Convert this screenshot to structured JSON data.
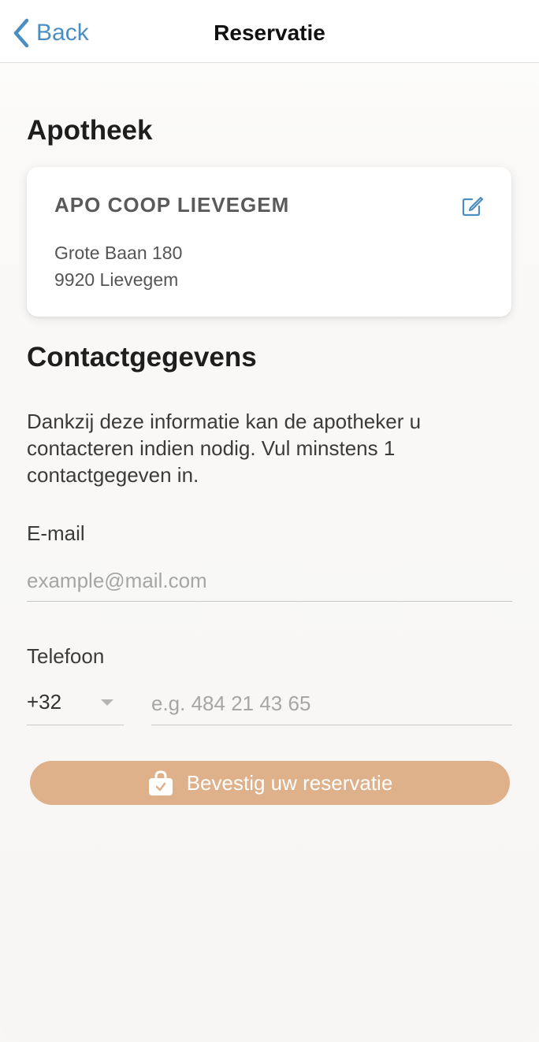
{
  "header": {
    "back_label": "Back",
    "title": "Reservatie"
  },
  "pharmacy": {
    "section_title": "Apotheek",
    "name": "APO COOP LIEVEGEM",
    "address_line1": "Grote Baan 180",
    "address_line2": "9920 Lievegem",
    "edit_icon": "edit-icon"
  },
  "contact": {
    "section_title": "Contactgegevens",
    "description": "Dankzij deze informatie kan de apotheker u contacteren indien nodig. Vul minstens 1 contactgegeven in.",
    "email": {
      "label": "E-mail",
      "value": "",
      "placeholder": "example@mail.com"
    },
    "phone": {
      "label": "Telefoon",
      "country_code": "+32",
      "value": "",
      "placeholder": "e.g. 484 21 43 65"
    }
  },
  "confirm": {
    "label": "Bevestig uw reservatie",
    "icon": "shopping-bag-check-icon"
  },
  "colors": {
    "accent": "#4b8fc0",
    "button": "#dfb18b",
    "background": "#f8f7f5"
  }
}
